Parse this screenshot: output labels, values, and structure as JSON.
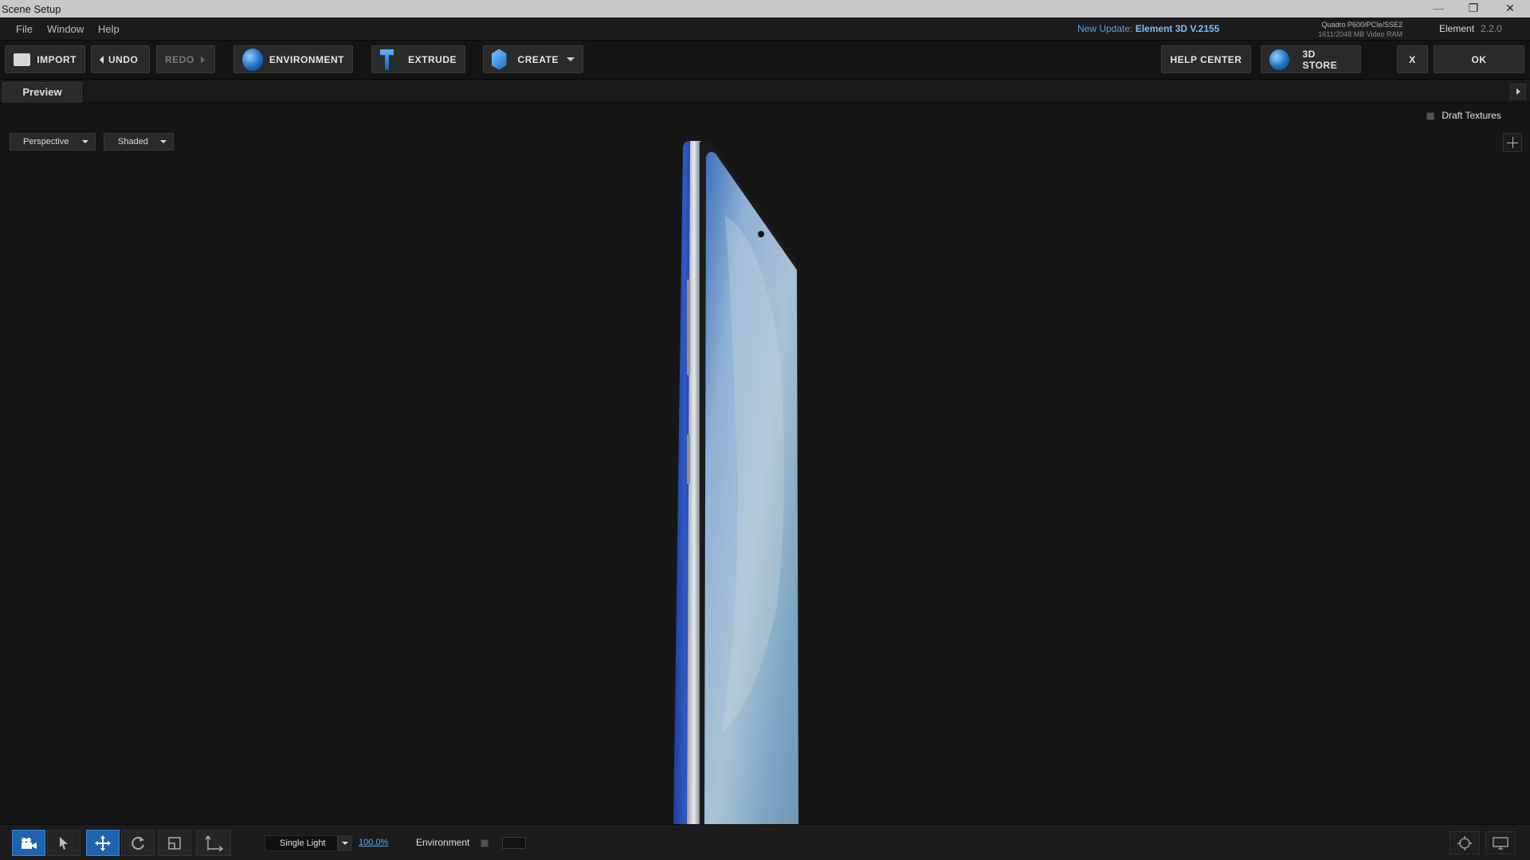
{
  "window": {
    "title": "Scene Setup",
    "minimize": "—",
    "restore": "❐",
    "close": "✕"
  },
  "menubar": {
    "items": [
      "File",
      "Window",
      "Help"
    ],
    "update_prefix": "New Update:",
    "update_name": "Element 3D V.2155",
    "gpu_name": "Quadro P600/PCIe/SSE2",
    "gpu_ram": "1611/2048 MB Video RAM",
    "product": "Element",
    "version": "2.2.0"
  },
  "toolbar": {
    "import": "IMPORT",
    "undo": "UNDO",
    "redo": "REDO",
    "environment": "ENVIRONMENT",
    "extrude": "EXTRUDE",
    "create": "CREATE",
    "help_center": "HELP CENTER",
    "store": "3D STORE",
    "cancel": "X",
    "ok": "OK"
  },
  "tabs": {
    "preview": "Preview"
  },
  "options": {
    "draft_textures": "Draft Textures",
    "draft_textures_checked": false
  },
  "viewport": {
    "camera_mode": "Perspective",
    "shading_mode": "Shaded",
    "background_color": "#161616"
  },
  "bottombar": {
    "tools": [
      "camera-icon",
      "select-icon",
      "move-icon",
      "rotate-icon",
      "scale-icon",
      "axis-icon"
    ],
    "active_tool": "move-icon",
    "lighting": "Single Light",
    "light_intensity": "100.0%",
    "environment_label": "Environment",
    "environment_checked": false
  },
  "colors": {
    "accent": "#1e63b0",
    "link": "#5ea7ee",
    "update": "#7dbdf5"
  }
}
